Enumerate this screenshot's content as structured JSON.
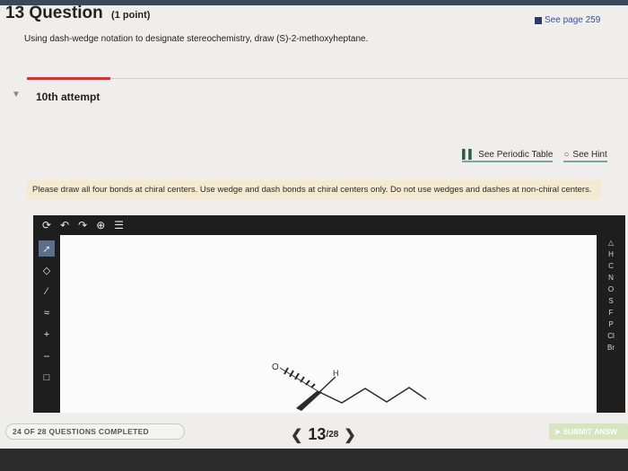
{
  "question": {
    "number": "13",
    "word": "Question",
    "points": "(1 point)",
    "text": "Using dash-wedge notation to designate stereochemistry, draw (S)-2-methoxyheptane.",
    "see_page": "See page 259"
  },
  "attempt": {
    "label": "10th attempt"
  },
  "links": {
    "periodic_table": "See Periodic Table",
    "hint": "See Hint"
  },
  "instruction": "Please draw all four bonds at chiral centers. Use wedge and dash bonds at chiral centers only. Do not use wedges and dashes at non-chiral centers.",
  "editor": {
    "atoms": [
      "H",
      "C",
      "N",
      "O",
      "S",
      "F",
      "P",
      "Cl",
      "Br"
    ],
    "molecule_labels": {
      "methoxy": "O",
      "hydrogen": "H"
    }
  },
  "footer": {
    "progress": "24 OF 28 QUESTIONS COMPLETED",
    "current": "13",
    "total": "/28",
    "submit": "SUBMIT ANSW"
  },
  "colors": {
    "accent_red": "#d9322e",
    "link_blue": "#3b4fa0",
    "instruction_bg": "#f5ead0"
  }
}
